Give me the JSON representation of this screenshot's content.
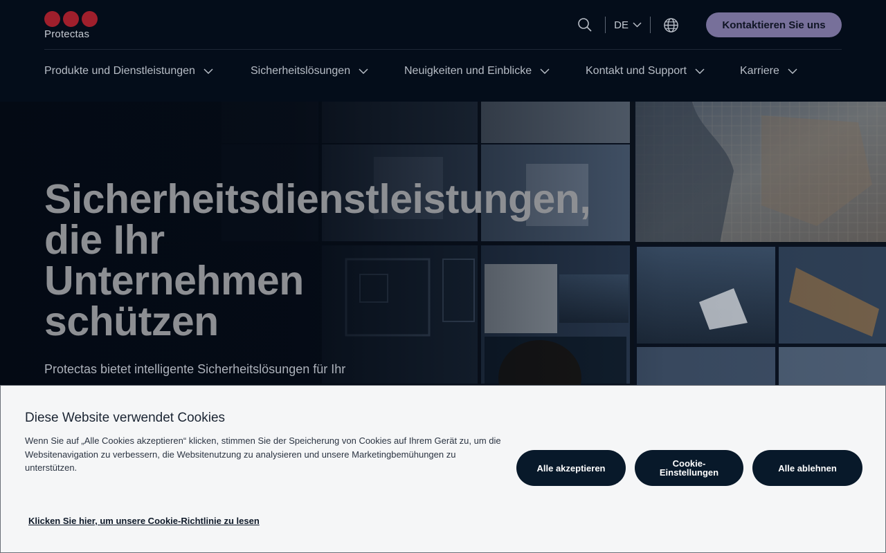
{
  "header": {
    "brand_name": "Protectas",
    "language": "DE",
    "contact_label": "Kontaktieren Sie uns",
    "icons": {
      "search": "search-icon",
      "language_chevron": "chevron-down-icon",
      "globe": "globe-icon"
    }
  },
  "nav": {
    "items": [
      {
        "label": "Produkte und Dienstleistungen"
      },
      {
        "label": "Sicherheitslösungen"
      },
      {
        "label": "Neuigkeiten und Einblicke"
      },
      {
        "label": "Kontakt und Support"
      },
      {
        "label": "Karriere"
      }
    ]
  },
  "hero": {
    "title_lines": [
      "Sicherheitsdienstleistungen,",
      "die Ihr",
      "Unternehmen",
      "schützen"
    ],
    "subtitle": "Protectas bietet intelligente Sicherheitslösungen für Ihr"
  },
  "cookie": {
    "title": "Diese Website verwendet Cookies",
    "text": "Wenn Sie auf „Alle Cookies akzeptieren“ klicken, stimmen Sie der Speicherung von Cookies auf Ihrem Gerät zu, um die Websitenavigation zu verbessern, die Websitenutzung zu analysieren und unsere Marketingbemühungen zu unterstützen.",
    "accept_label": "Alle akzeptieren",
    "settings_label": "Cookie-Einstellungen",
    "reject_label": "Alle ablehnen",
    "policy_link": "Klicken Sie hier, um unsere Cookie-Richtlinie zu lesen"
  },
  "colors": {
    "header_bg": "#040d1a",
    "brand_red": "#a01f2c",
    "contact_button": "#77709a",
    "cookie_button": "#08192a",
    "cookie_bg": "#f5f6f7"
  }
}
